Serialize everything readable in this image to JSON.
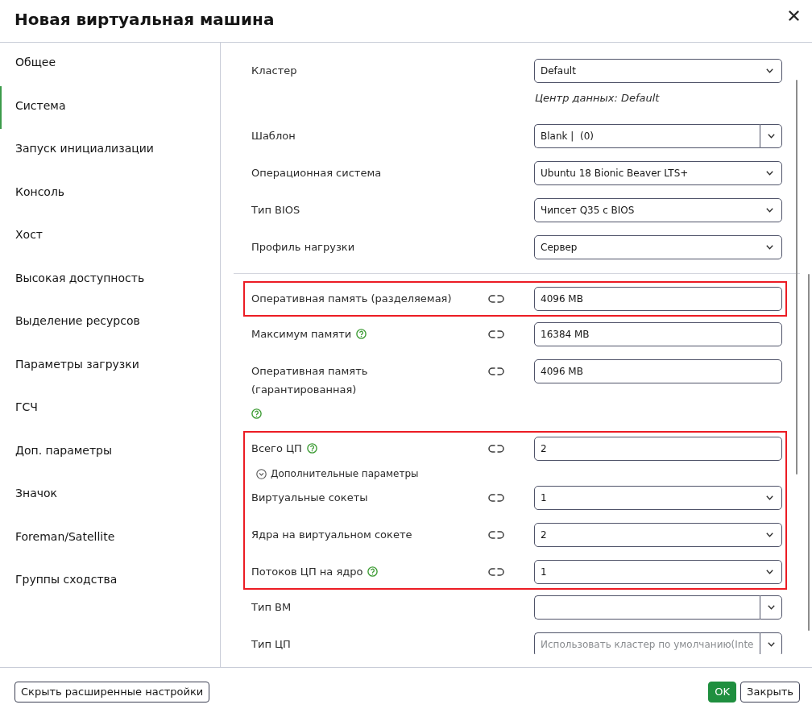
{
  "dialog": {
    "title": "Новая виртуальная машина"
  },
  "sidebar": {
    "items": [
      {
        "label": "Общее",
        "selected": false
      },
      {
        "label": "Система",
        "selected": true
      },
      {
        "label": "Запуск инициализации",
        "selected": false
      },
      {
        "label": "Консоль",
        "selected": false
      },
      {
        "label": "Хост",
        "selected": false
      },
      {
        "label": "Высокая доступность",
        "selected": false
      },
      {
        "label": "Выделение ресурсов",
        "selected": false
      },
      {
        "label": "Параметры загрузки",
        "selected": false
      },
      {
        "label": "ГСЧ",
        "selected": false
      },
      {
        "label": "Доп. параметры",
        "selected": false
      },
      {
        "label": "Значок",
        "selected": false
      },
      {
        "label": "Foreman/Satellite",
        "selected": false
      },
      {
        "label": "Группы сходства",
        "selected": false
      }
    ]
  },
  "form": {
    "sections": [
      {
        "groups": [
          {
            "highlighted": false,
            "rows": [
              {
                "kind": "select",
                "label": "Кластер",
                "help": false,
                "linked": false,
                "value": "Default",
                "note": "Центр данных: Default"
              },
              {
                "kind": "split_select",
                "label": "Шаблон",
                "help": false,
                "linked": false,
                "value": "Blank |  (0)"
              },
              {
                "kind": "select",
                "label": "Операционная система",
                "help": false,
                "linked": false,
                "value": "Ubuntu 18 Bionic Beaver LTS+"
              },
              {
                "kind": "select",
                "label": "Тип BIOS",
                "help": false,
                "linked": false,
                "value": "Чипсет Q35 с BIOS"
              },
              {
                "kind": "select",
                "label": "Профиль нагрузки",
                "help": false,
                "linked": false,
                "value": "Сервер"
              }
            ]
          }
        ]
      },
      {
        "groups": [
          {
            "highlighted": true,
            "rows": [
              {
                "kind": "input",
                "label": "Оперативная память (разделяемая)",
                "help": false,
                "linked": true,
                "value": "4096 MB"
              }
            ]
          },
          {
            "highlighted": false,
            "rows": [
              {
                "kind": "input",
                "label": "Максимум памяти",
                "help": true,
                "linked": true,
                "value": "16384 MB"
              },
              {
                "kind": "input",
                "label": "Оперативная память (гарантированная)",
                "help": true,
                "linked": true,
                "value": "4096 MB"
              }
            ]
          },
          {
            "highlighted": true,
            "rows": [
              {
                "kind": "input",
                "label": "Всего ЦП",
                "help": true,
                "linked": true,
                "value": "2"
              },
              {
                "kind": "toggle",
                "label": "Дополнительные параметры",
                "expanded": true,
                "rows": [
                  {
                    "kind": "select",
                    "label": "Виртуальные сокеты",
                    "help": false,
                    "linked": true,
                    "value": "1"
                  },
                  {
                    "kind": "select",
                    "label": "Ядра на виртуальном сокете",
                    "help": false,
                    "linked": true,
                    "value": "2"
                  },
                  {
                    "kind": "select",
                    "label": "Потоков ЦП на ядро",
                    "help": true,
                    "linked": true,
                    "value": "1"
                  }
                ]
              }
            ]
          },
          {
            "highlighted": false,
            "rows": [
              {
                "kind": "split_select",
                "label": "Тип ВМ",
                "help": false,
                "linked": false
              },
              {
                "kind": "split_select",
                "label": "Тип ЦП",
                "help": false,
                "linked": false,
                "placeholder": "Использовать кластер по умолчанию(Inte"
              }
            ]
          }
        ]
      }
    ]
  },
  "footer": {
    "left_buttons": [
      {
        "kind": "secondary",
        "label": "Скрыть расширенные настройки"
      }
    ],
    "right_buttons": [
      {
        "kind": "primary",
        "label": "OK"
      },
      {
        "kind": "secondary",
        "label": "Закрыть"
      }
    ]
  }
}
